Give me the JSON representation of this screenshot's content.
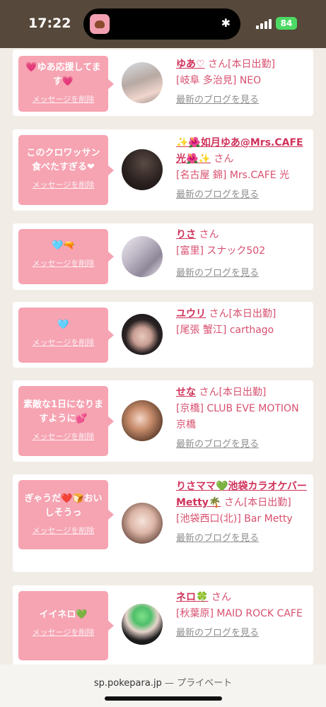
{
  "status_bar": {
    "time": "17:22",
    "battery": "84"
  },
  "items": [
    {
      "message": "💗ゆあ応援してます💗",
      "delete_label": "メッセージを削除",
      "name": "ゆあ♡",
      "san": "さん",
      "tag": "[本日出勤]",
      "area": "[岐阜 多治見] NEO",
      "blog": "最新のブログを見る"
    },
    {
      "message": "このクロワッサン食べたすぎる❤",
      "delete_label": "メッセージを削除",
      "name": "✨🌺如月ゆあ@Mrs.CAFE光🌺✨",
      "san": "さん",
      "tag": "",
      "area": "[名古屋 錦] Mrs.CAFE 光",
      "blog": "最新のブログを見る"
    },
    {
      "message": "🩵🔫",
      "delete_label": "メッセージを削除",
      "name": "りさ",
      "san": "さん",
      "tag": "",
      "area": "[富里] スナック502",
      "blog": "最新のブログを見る"
    },
    {
      "message": "🩵",
      "delete_label": "メッセージを削除",
      "name": "ユウリ",
      "san": "さん",
      "tag": "[本日出勤]",
      "area": "[尾張 蟹江] carthago",
      "blog": ""
    },
    {
      "message": "素敵な1日になりますように💕",
      "delete_label": "メッセージを削除",
      "name": "せな",
      "san": "さん",
      "tag": "[本日出勤]",
      "area": "[京橋] CLUB EVE MOTION 京橋",
      "blog": "最新のブログを見る"
    },
    {
      "message": "ぎゃうだ❤️🍞おいしそうっ",
      "delete_label": "メッセージを削除",
      "name": "りさママ💚池袋カラオケバーMetty🌴",
      "san": "さん",
      "tag": "[本日出勤]",
      "area": "[池袋西口(北)] Bar Metty",
      "blog": "最新のブログを見る"
    },
    {
      "message": "イイネロ💚",
      "delete_label": "メッセージを削除",
      "name": "ネロ🍀",
      "san": "さん",
      "tag": "",
      "area": "[秋葉原] MAID ROCK CAFE",
      "blog": "最新のブログを見る"
    }
  ],
  "bottom_bar": {
    "domain": "sp.pokepara.jp",
    "separator": "—",
    "mode": "プライベート"
  }
}
